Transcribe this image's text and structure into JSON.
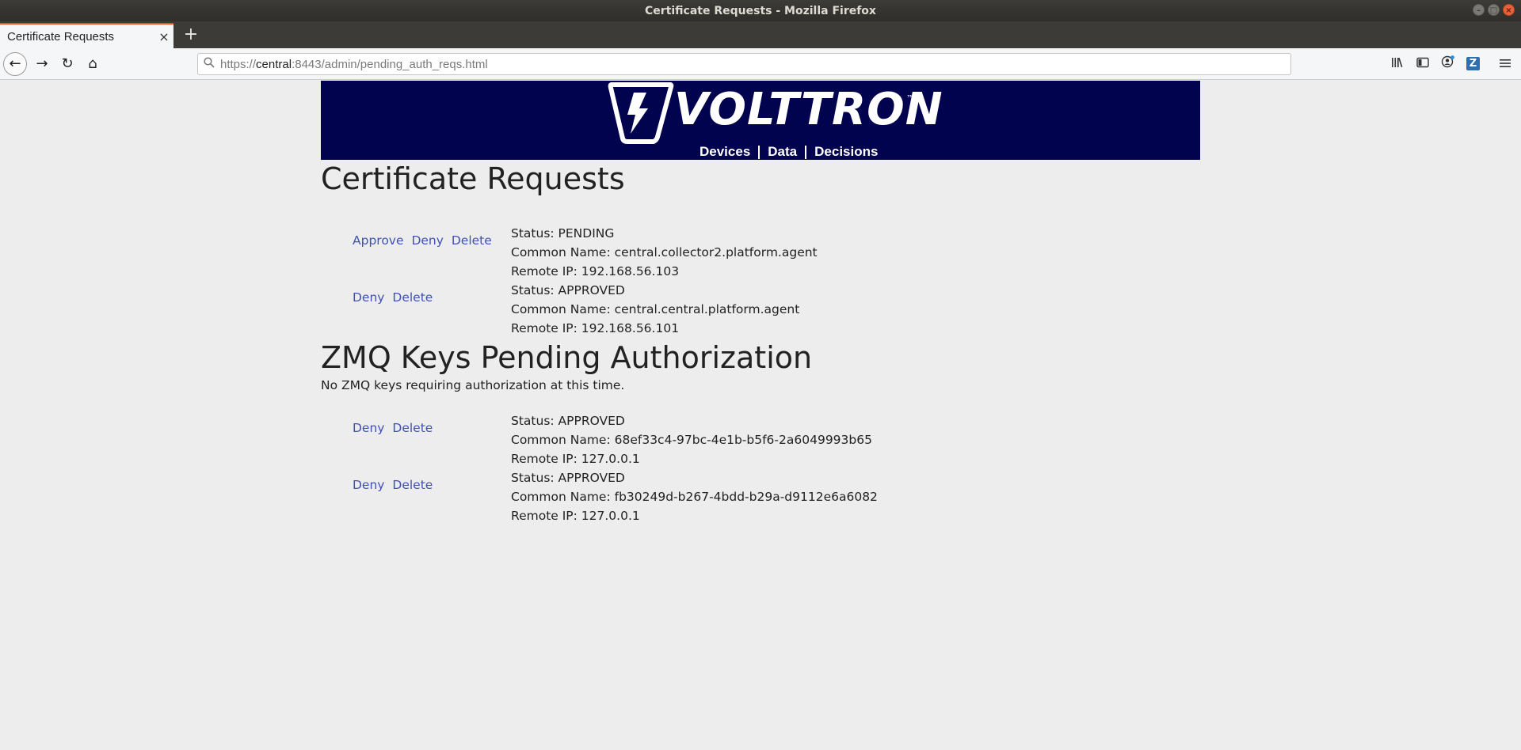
{
  "window": {
    "title": "Certificate Requests - Mozilla Firefox"
  },
  "browser": {
    "tab_title": "Certificate Requests",
    "url_prefix": "https://",
    "url_host": "central",
    "url_rest": ":8443/admin/pending_auth_reqs.html"
  },
  "banner": {
    "logo_text": "VOLTTRON",
    "logo_tm": "™",
    "nav": [
      "Devices",
      "Data",
      "Decisions"
    ],
    "background_color": "#02034f"
  },
  "cert_section": {
    "heading": "Certificate Requests",
    "requests": [
      {
        "actions": [
          "Approve",
          "Deny",
          "Delete"
        ],
        "status": "Status: PENDING",
        "common_name": "Common Name: central.collector2.platform.agent",
        "remote_ip": "Remote IP: 192.168.56.103"
      },
      {
        "actions": [
          "Deny",
          "Delete"
        ],
        "status": "Status: APPROVED",
        "common_name": "Common Name: central.central.platform.agent",
        "remote_ip": "Remote IP: 192.168.56.101"
      }
    ]
  },
  "zmq_section": {
    "heading": "ZMQ Keys Pending Authorization",
    "empty_message": "No ZMQ keys requiring authorization at this time.",
    "keys": [
      {
        "actions": [
          "Deny",
          "Delete"
        ],
        "status": "Status: APPROVED",
        "common_name": "Common Name: 68ef33c4-97bc-4e1b-b5f6-2a6049993b65",
        "remote_ip": "Remote IP: 127.0.0.1"
      },
      {
        "actions": [
          "Deny",
          "Delete"
        ],
        "status": "Status: APPROVED",
        "common_name": "Common Name: fb30249d-b267-4bdd-b29a-d9112e6a6082",
        "remote_ip": "Remote IP: 127.0.0.1"
      }
    ]
  },
  "colors": {
    "link": "#3f51b5",
    "tab_accent": "#e95420"
  }
}
